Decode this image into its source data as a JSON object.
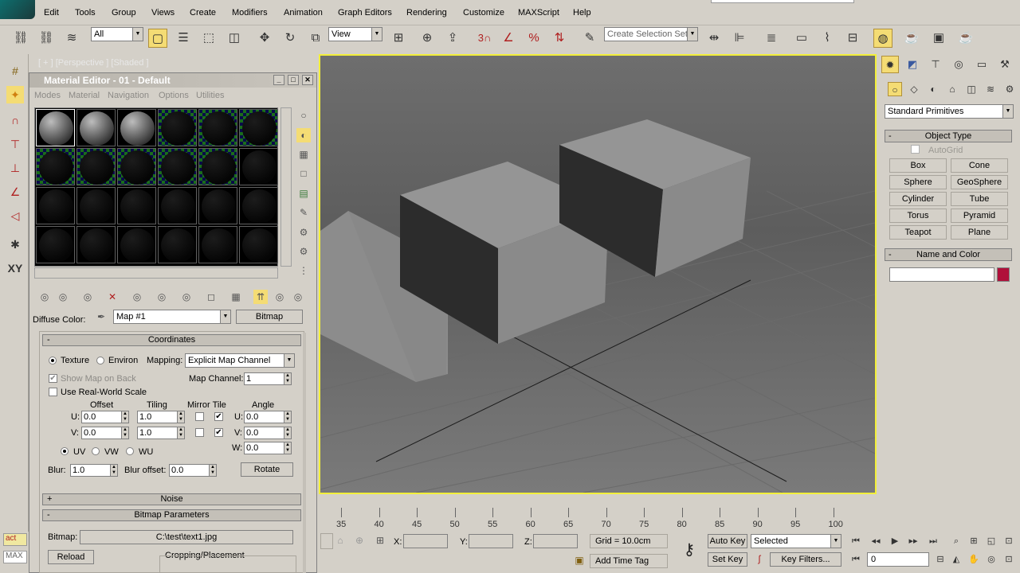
{
  "menu": [
    "Edit",
    "Tools",
    "Group",
    "Views",
    "Create",
    "Modifiers",
    "Animation",
    "Graph Editors",
    "Rendering",
    "Customize",
    "MAXScript",
    "Help"
  ],
  "toolbar": {
    "filter": "All",
    "ref_coord": "View",
    "snap_number": "3",
    "selection_set": "Create Selection Set"
  },
  "viewport": {
    "label": "[ + ] [Perspective ] [Shaded ]"
  },
  "left_strip": {
    "xy_label": "XY"
  },
  "material_editor": {
    "title": "Material Editor - 01 - Default",
    "menus": [
      "Modes",
      "Material",
      "Navigation",
      "Options",
      "Utilities"
    ],
    "diffuse_label": "Diffuse Color:",
    "map_name": "Map #1",
    "map_type": "Bitmap",
    "coordinates": {
      "header": "Coordinates",
      "texture_label": "Texture",
      "environ_label": "Environ",
      "mapping_label": "Mapping:",
      "mapping_value": "Explicit Map Channel",
      "show_map_on_back": "Show Map on Back",
      "map_channel_label": "Map Channel:",
      "map_channel_value": "1",
      "real_world": "Use Real-World Scale",
      "offset_label": "Offset",
      "tiling_label": "Tiling",
      "mirror_tile_label": "Mirror Tile",
      "angle_label": "Angle",
      "u_label": "U:",
      "v_label": "V:",
      "w_label": "W:",
      "offset_u": "0.0",
      "offset_v": "0.0",
      "tiling_u": "1.0",
      "tiling_v": "1.0",
      "angle_u": "0.0",
      "angle_v": "0.0",
      "angle_w": "0.0",
      "uv": "UV",
      "vw": "VW",
      "wu": "WU",
      "blur_label": "Blur:",
      "blur_value": "1.0",
      "blur_offset_label": "Blur offset:",
      "blur_offset_value": "0.0",
      "rotate": "Rotate"
    },
    "noise_header": "Noise",
    "bitmap_params_header": "Bitmap Parameters",
    "bitmap_label": "Bitmap:",
    "bitmap_path": "C:\\test\\text1.jpg",
    "reload": "Reload",
    "cropping": "Cropping/Placement"
  },
  "command_panel": {
    "category": "Standard Primitives",
    "object_type_header": "Object Type",
    "autogrid": "AutoGrid",
    "primitives": [
      "Box",
      "Cone",
      "Sphere",
      "GeoSphere",
      "Cylinder",
      "Tube",
      "Torus",
      "Pyramid",
      "Teapot",
      "Plane"
    ],
    "name_color_header": "Name and Color",
    "object_color": "#b0103a"
  },
  "timeline": {
    "ticks": [
      "35",
      "40",
      "45",
      "50",
      "55",
      "60",
      "65",
      "70",
      "75",
      "80",
      "85",
      "90",
      "95",
      "100"
    ]
  },
  "status": {
    "x_label": "X:",
    "y_label": "Y:",
    "z_label": "Z:",
    "grid": "Grid = 10.0cm",
    "add_time_tag": "Add Time Tag",
    "auto_key": "Auto Key",
    "set_key": "Set Key",
    "selected": "Selected",
    "key_filters": "Key Filters...",
    "frame": "0",
    "maxscript_label": "MAX",
    "action_label": "act"
  }
}
